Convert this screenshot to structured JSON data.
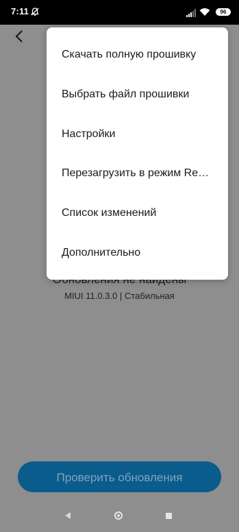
{
  "status_bar": {
    "time": "7:11",
    "battery": "96",
    "icons": [
      "alarm-off-icon",
      "signal-icon",
      "wifi-icon",
      "battery-icon"
    ]
  },
  "header": {
    "back_icon": "chevron-left-icon"
  },
  "main": {
    "status_title": "Обновления не найдены",
    "version": "MIUI 11.0.3.0 | Стабильная",
    "check_button": "Проверить обновления"
  },
  "menu": {
    "items": [
      {
        "label": "Скачать полную прошивку"
      },
      {
        "label": "Выбрать файл прошивки"
      },
      {
        "label": "Настройки"
      },
      {
        "label": "Перезагрузить в режим Recovery"
      },
      {
        "label": "Список изменений"
      },
      {
        "label": "Дополнительно"
      }
    ]
  },
  "colors": {
    "accent": "#0a5c8c",
    "overlay": "#8e8e8e",
    "menu_bg": "#ffffff"
  }
}
